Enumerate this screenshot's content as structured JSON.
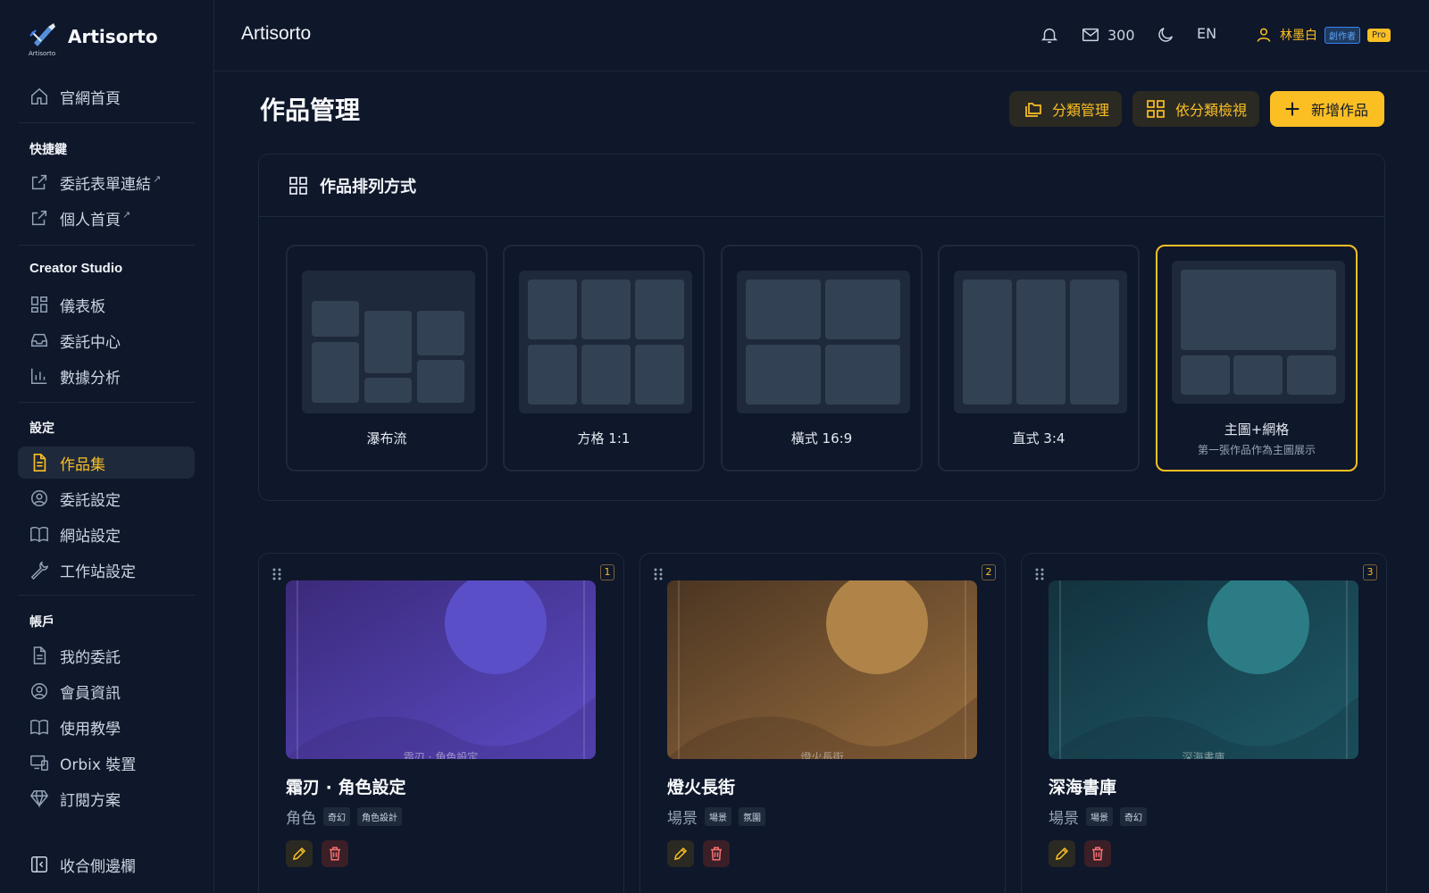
{
  "brand": {
    "name": "Artisorto",
    "logo_text": "Artisorto"
  },
  "sidebar": {
    "home": "官網首頁",
    "sections": {
      "shortcuts": "快捷鍵",
      "studio": "Creator Studio",
      "settings": "設定",
      "account": "帳戶"
    },
    "shortcut_items": [
      {
        "label": "委託表單連結",
        "mark": "↗"
      },
      {
        "label": "個人首頁",
        "mark": "↗"
      }
    ],
    "studio_items": [
      "儀表板",
      "委託中心",
      "數據分析"
    ],
    "settings_items": [
      "作品集",
      "委託設定",
      "網站設定",
      "工作站設定"
    ],
    "account_items": [
      "我的委託",
      "會員資訊",
      "使用教學",
      "Orbix 裝置",
      "訂閱方案"
    ],
    "collapse": "收合側邊欄",
    "active_item": "作品集"
  },
  "header": {
    "title": "Artisorto",
    "mail_count": "300",
    "lang": "EN",
    "user_name": "林墨白",
    "role_badge": "創作者",
    "plan_badge": "Pro"
  },
  "main": {
    "page_title": "作品管理",
    "buttons": {
      "category_manage": "分類管理",
      "view_by_category": "依分類檢視",
      "add_work": "新增作品"
    },
    "layout_panel": {
      "title": "作品排列方式",
      "options": [
        {
          "label": "瀑布流",
          "sub": ""
        },
        {
          "label": "方格 1:1",
          "sub": ""
        },
        {
          "label": "橫式 16:9",
          "sub": ""
        },
        {
          "label": "直式 3:4",
          "sub": ""
        },
        {
          "label": "主圖+網格",
          "sub": "第一張作品作為主圖展示"
        }
      ],
      "selected": "主圖+網格"
    },
    "works": [
      {
        "index": "1",
        "title": "霜刃 · 角色設定",
        "caption": "霜刃 · 角色設定",
        "category": "角色",
        "tags": [
          "奇幻",
          "角色設計"
        ],
        "color_a": "#3b2a7a",
        "color_b": "#5b4bc4",
        "sun": "#5b4fc8"
      },
      {
        "index": "2",
        "title": "燈火長街",
        "caption": "燈火長街",
        "category": "場景",
        "tags": [
          "場景",
          "氛圍"
        ],
        "color_a": "#4a3522",
        "color_b": "#9a6e3e",
        "sun": "#b08448"
      },
      {
        "index": "3",
        "title": "深海書庫",
        "caption": "深海書庫",
        "category": "場景",
        "tags": [
          "場景",
          "奇幻"
        ],
        "color_a": "#13323f",
        "color_b": "#1e5a66",
        "sun": "#2b7c85"
      }
    ]
  }
}
